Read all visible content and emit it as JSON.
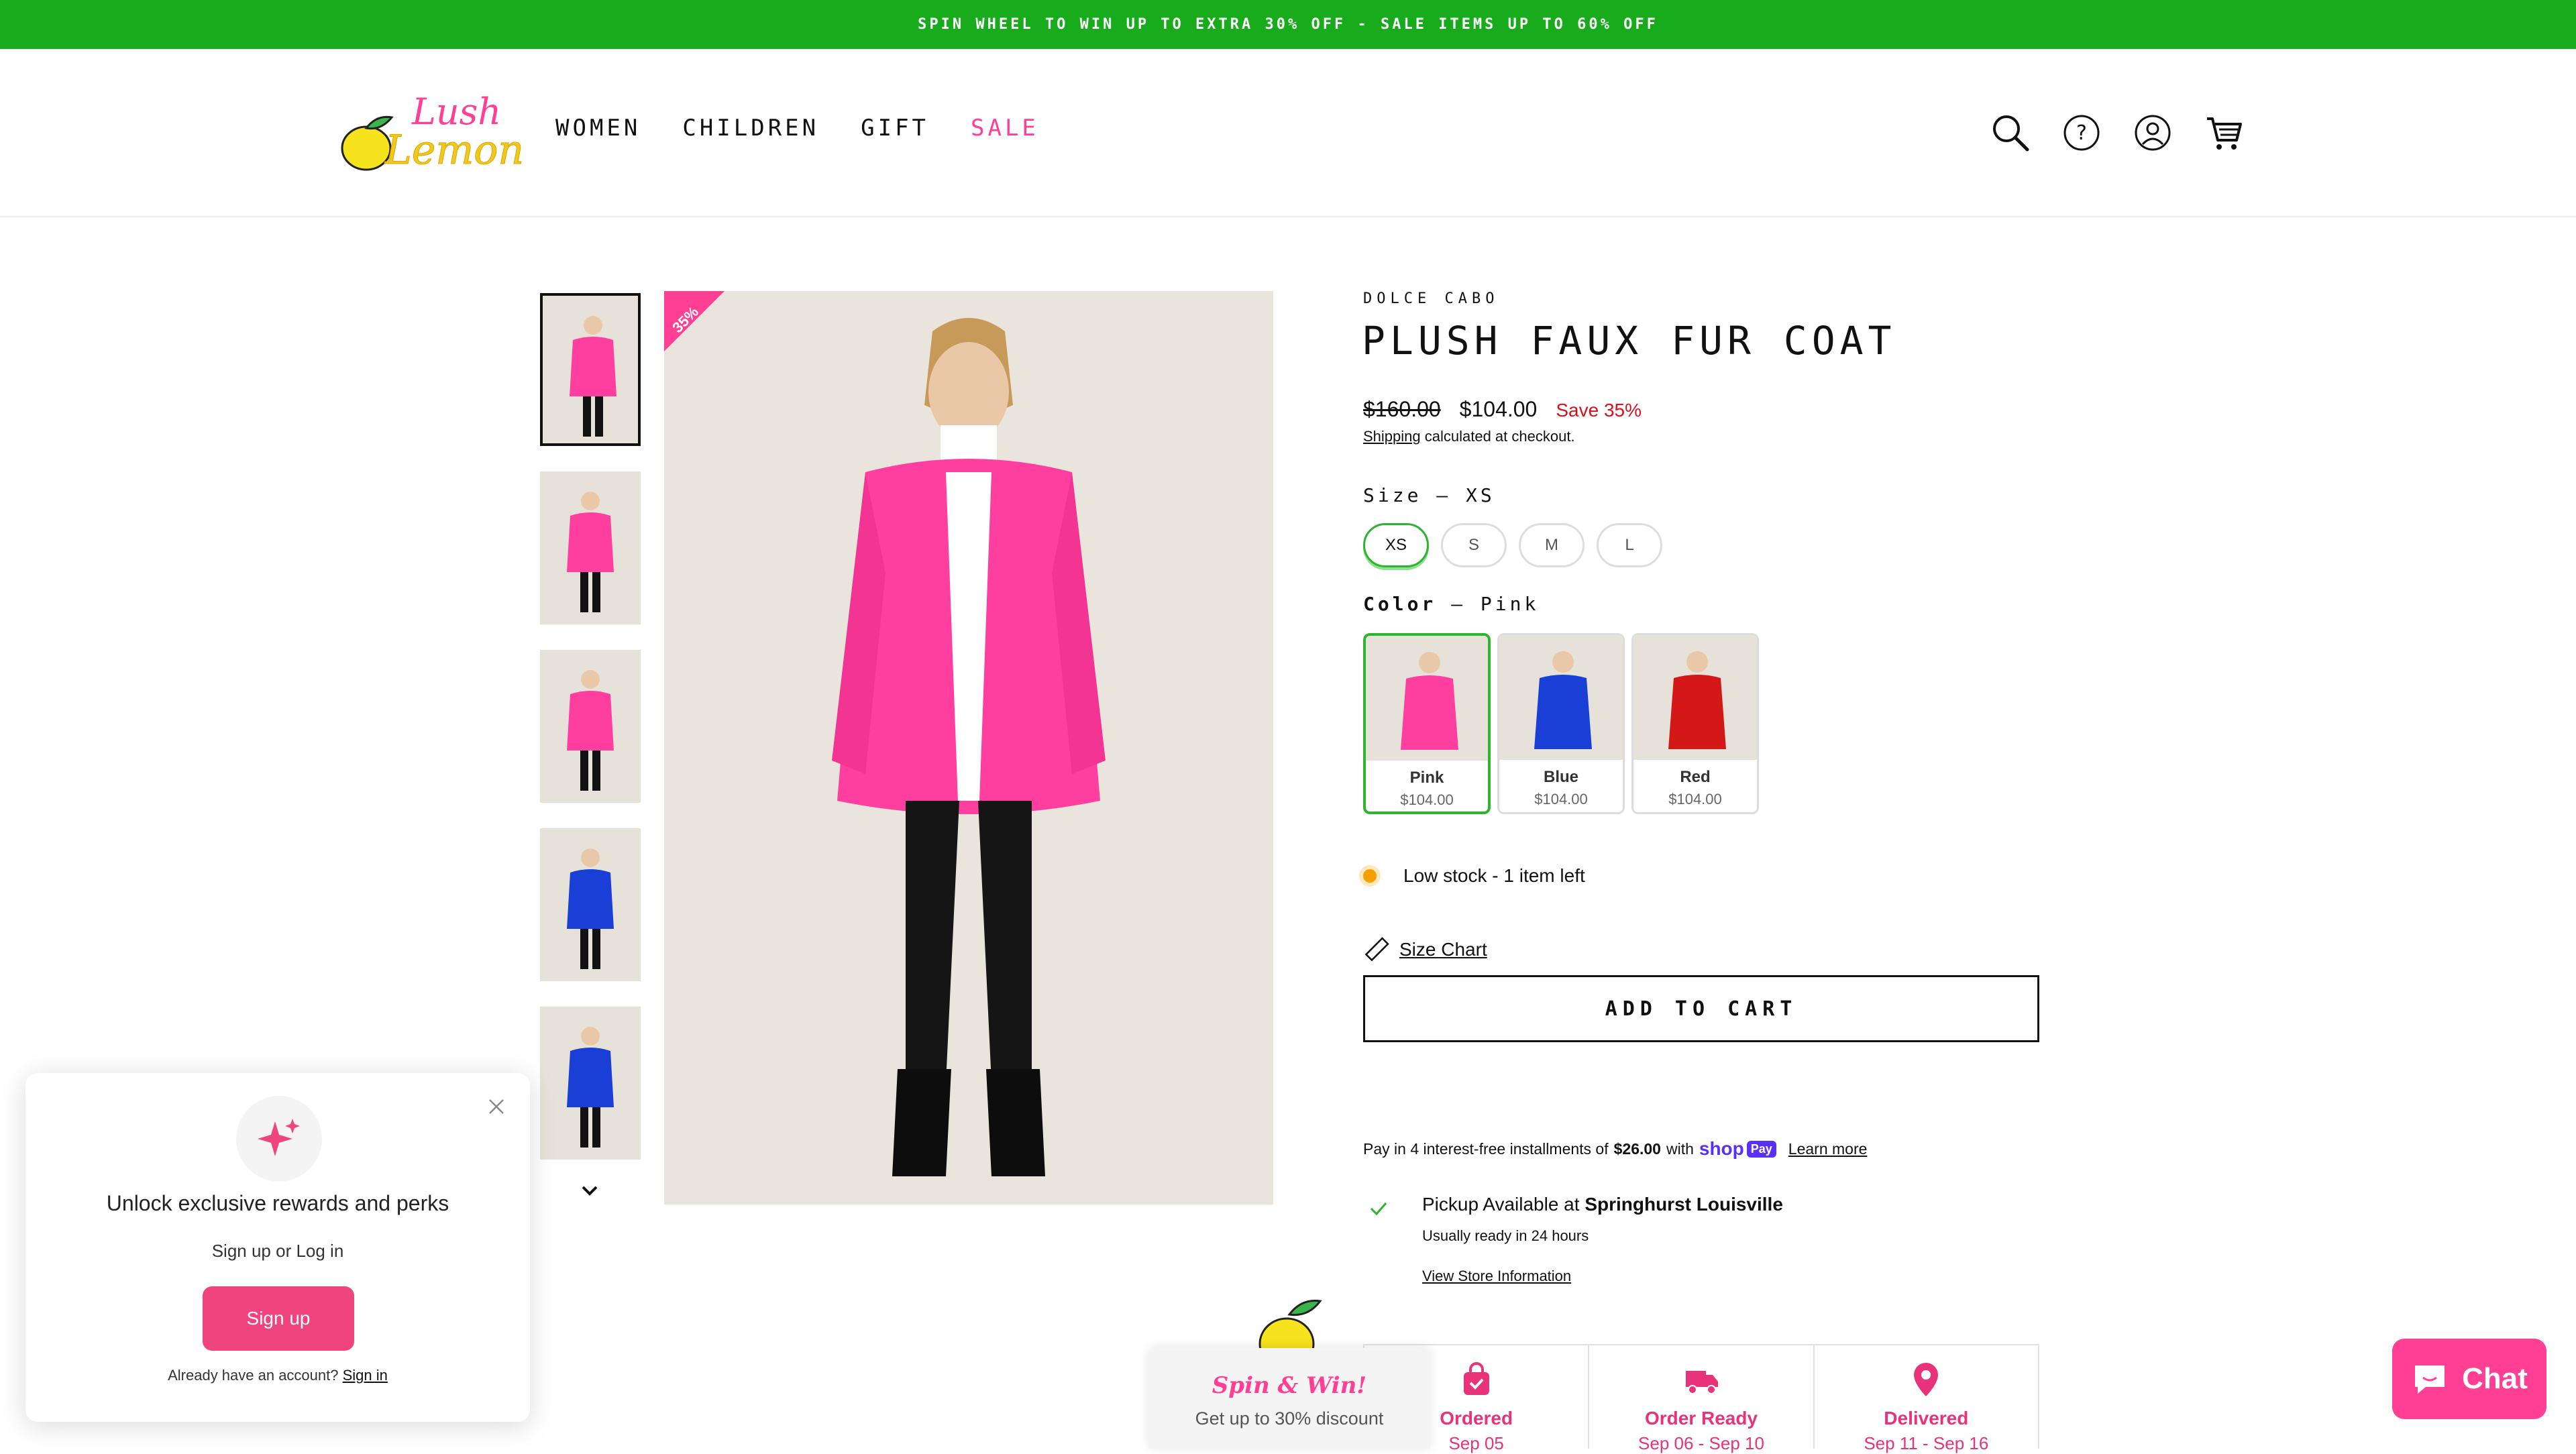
{
  "announcement": "SPIN WHEEL TO WIN UP TO EXTRA 30% OFF - SALE ITEMS UP TO 60% OFF",
  "brand": {
    "line1": "Lush",
    "line2": "Lemon"
  },
  "nav": {
    "women": "WOMEN",
    "children": "CHILDREN",
    "gift": "GIFT",
    "sale": "SALE"
  },
  "header_icons": [
    "search-icon",
    "help-icon",
    "account-icon",
    "cart-icon"
  ],
  "gallery": {
    "badge": "35%",
    "thumb_colors": [
      "#ff3f9f",
      "#ff3f9f",
      "#ff3f9f",
      "#1a3fd6",
      "#1a3fd6"
    ]
  },
  "product": {
    "vendor": "DOLCE CABO",
    "title": "PLUSH FAUX FUR COAT",
    "price_compare": "$160.00",
    "price": "$104.00",
    "save": "Save 35%",
    "shipping_link": "Shipping",
    "shipping_rest": " calculated at checkout."
  },
  "size": {
    "label": "Size",
    "selected": "XS",
    "options": [
      "XS",
      "S",
      "M",
      "L"
    ]
  },
  "color": {
    "label": "Color",
    "selected": "Pink",
    "swatches": [
      {
        "name": "Pink",
        "price": "$104.00",
        "hex": "#ff3f9f"
      },
      {
        "name": "Blue",
        "price": "$104.00",
        "hex": "#1a3fd6"
      },
      {
        "name": "Red",
        "price": "$104.00",
        "hex": "#d41818"
      }
    ]
  },
  "stock": "Low stock - 1 item left",
  "size_chart": "Size Chart",
  "add_to_cart": "ADD TO CART",
  "shop_pay": {
    "prefix": "Pay in 4 interest-free installments of ",
    "amount": "$26.00",
    "with": " with",
    "brand": "shop",
    "badge": "Pay",
    "learn_more": "Learn more"
  },
  "pickup": {
    "prefix": "Pickup Available at ",
    "store": "Springhurst Louisville",
    "ready": "Usually ready in 24 hours",
    "view": "View Store Information"
  },
  "timeline": [
    {
      "label": "Ordered",
      "date": "Sep 05"
    },
    {
      "label": "Order Ready",
      "date": "Sep 06 - Sep 10"
    },
    {
      "label": "Delivered",
      "date": "Sep 11 - Sep 16"
    }
  ],
  "rewards": {
    "heading": "Unlock exclusive rewards and perks",
    "sub": "Sign up or Log in",
    "button": "Sign up",
    "foot_text": "Already have an account? ",
    "sign_in": "Sign in"
  },
  "spin": {
    "title": "Spin & Win!",
    "subtitle": "Get up to 30% discount"
  },
  "chat": {
    "label": "Chat"
  },
  "colors": {
    "brand_pink": "#ff3f94",
    "announce_green": "#18ac1c",
    "select_green": "#2db52f",
    "save_red": "#d4131d"
  }
}
